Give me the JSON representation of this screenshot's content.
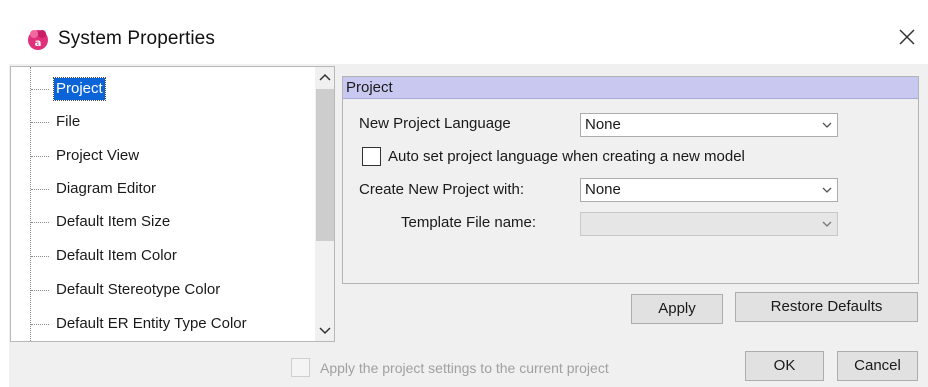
{
  "window": {
    "title": "System Properties",
    "close_glyph": "✕"
  },
  "tree": {
    "items": [
      {
        "label": "Project",
        "selected": true
      },
      {
        "label": "File",
        "selected": false
      },
      {
        "label": "Project View",
        "selected": false
      },
      {
        "label": "Diagram Editor",
        "selected": false
      },
      {
        "label": "Default Item Size",
        "selected": false
      },
      {
        "label": "Default Item Color",
        "selected": false
      },
      {
        "label": "Default Stereotype Color",
        "selected": false
      },
      {
        "label": "Default ER Entity Type Color",
        "selected": false
      }
    ]
  },
  "panel": {
    "header": "Project",
    "new_project_language": {
      "label": "New Project Language",
      "value": "None"
    },
    "auto_set_checkbox": {
      "label": "Auto set project language when creating a new model",
      "checked": false
    },
    "create_new_project_with": {
      "label": "Create New Project with:",
      "value": "None"
    },
    "template_file_name": {
      "label": "Template File name:",
      "value": "",
      "enabled": false
    }
  },
  "buttons": {
    "apply": "Apply",
    "restore_defaults": "Restore Defaults",
    "ok": "OK",
    "cancel": "Cancel"
  },
  "footer": {
    "apply_to_current_checkbox": {
      "label": "Apply the project settings to the current project",
      "checked": false,
      "enabled": false
    }
  },
  "colors": {
    "selection": "#0a64d8",
    "panel_header": "#c8c8f0",
    "dialog_bg": "#f0f0f0"
  },
  "icons": {
    "app": "astah-app-icon",
    "close": "close-icon",
    "scroll_up": "chevron-up-icon",
    "scroll_down": "chevron-down-icon",
    "dropdown": "chevron-down-icon"
  }
}
